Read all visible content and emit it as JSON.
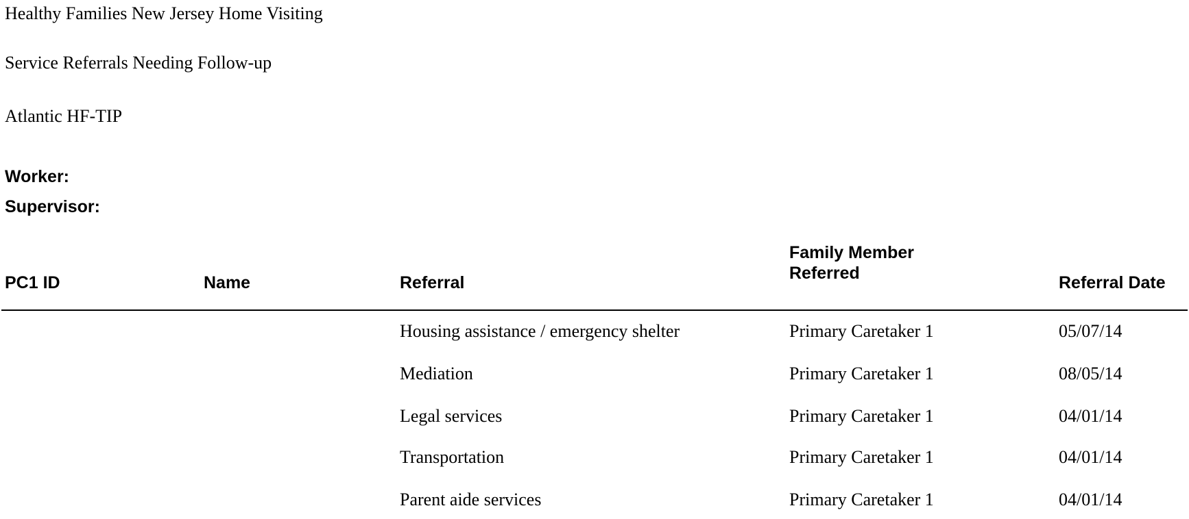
{
  "report": {
    "title": "Healthy Families New Jersey Home Visiting",
    "subtitle": "Service Referrals Needing Follow-up",
    "program": "Atlantic HF-TIP",
    "worker_label": "Worker:",
    "supervisor_label": "Supervisor:"
  },
  "table": {
    "headers": {
      "pc1_id": "PC1 ID",
      "name": "Name",
      "referral": "Referral",
      "family_member": "Family Member Referred",
      "referral_date": "Referral Date"
    },
    "rows": [
      {
        "pc1_id": "",
        "name": "",
        "referral": "Housing assistance / emergency shelter",
        "family_member": "Primary Caretaker 1",
        "referral_date": "05/07/14"
      },
      {
        "pc1_id": "",
        "name": "",
        "referral": "Mediation",
        "family_member": "Primary Caretaker 1",
        "referral_date": "08/05/14"
      },
      {
        "pc1_id": "",
        "name": "",
        "referral": "Legal services",
        "family_member": "Primary Caretaker 1",
        "referral_date": "04/01/14"
      },
      {
        "pc1_id": "",
        "name": "",
        "referral": "Transportation",
        "family_member": "Primary Caretaker 1",
        "referral_date": "04/01/14"
      },
      {
        "pc1_id": "",
        "name": "",
        "referral": "Parent aide services",
        "family_member": "Primary Caretaker 1",
        "referral_date": "04/01/14"
      }
    ]
  }
}
